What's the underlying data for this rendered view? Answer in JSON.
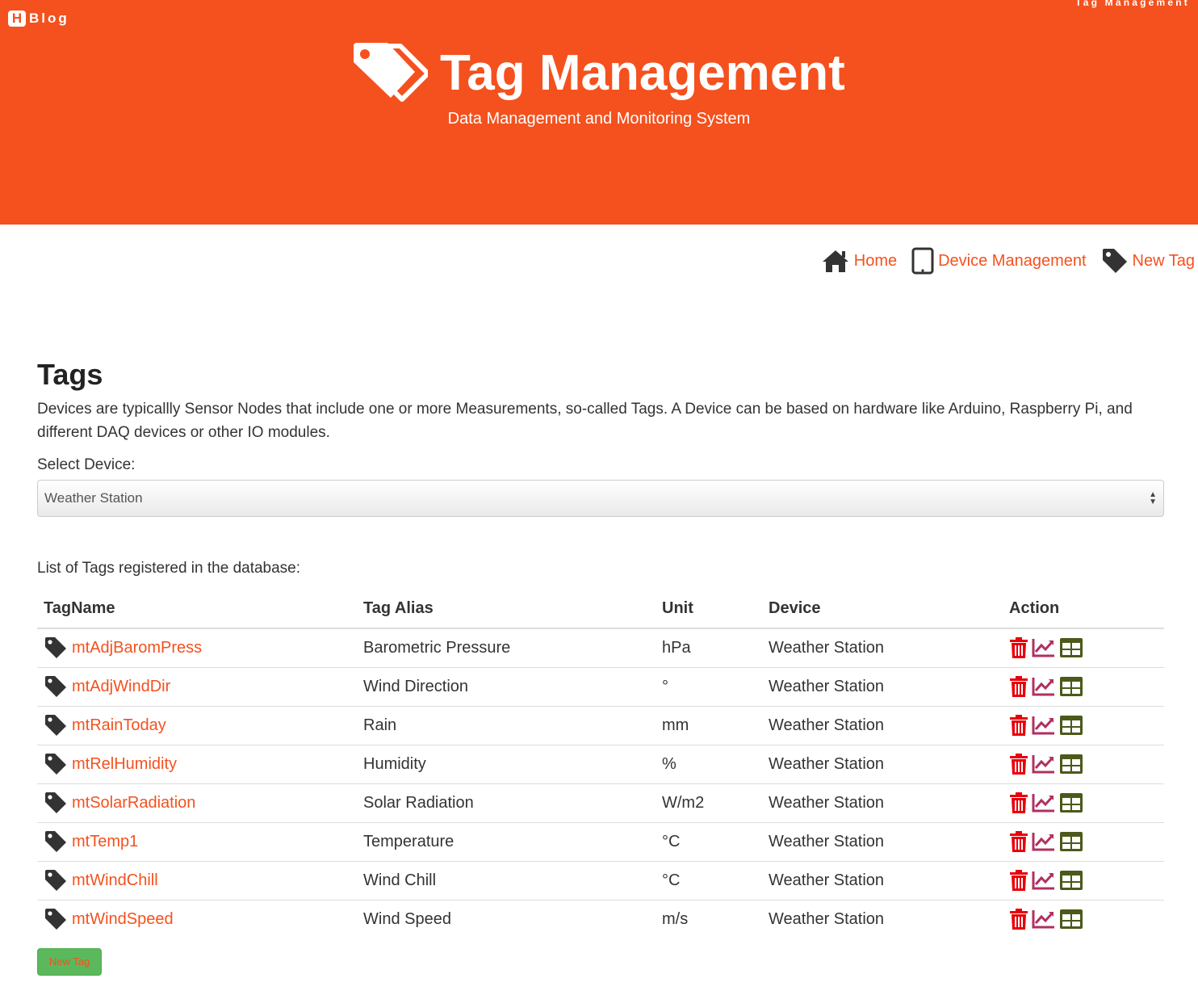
{
  "header": {
    "logo_letter": "H",
    "logo_text": "Blog",
    "top_right": "Tag Management",
    "title": "Tag Management",
    "subtitle": "Data Management and Monitoring System"
  },
  "nav": {
    "home": "Home",
    "devices": "Device Management",
    "new_tag": "New Tag"
  },
  "main": {
    "heading": "Tags",
    "description": "Devices are typicallly Sensor Nodes that include one or more Measurements, so-called Tags. A Device can be based on hardware like Arduino, Raspberry Pi, and different DAQ devices or other IO modules.",
    "select_label": "Select Device:",
    "selected_device": "Weather Station",
    "list_label": "List of Tags registered in the database:"
  },
  "table": {
    "headers": [
      "TagName",
      "Tag Alias",
      "Unit",
      "Device",
      "Action"
    ],
    "rows": [
      {
        "name": "mtAdjBaromPress",
        "alias": "Barometric Pressure",
        "unit": "hPa",
        "device": "Weather Station"
      },
      {
        "name": "mtAdjWindDir",
        "alias": "Wind Direction",
        "unit": "°",
        "device": "Weather Station"
      },
      {
        "name": "mtRainToday",
        "alias": "Rain",
        "unit": "mm",
        "device": "Weather Station"
      },
      {
        "name": "mtRelHumidity",
        "alias": "Humidity",
        "unit": "%",
        "device": "Weather Station"
      },
      {
        "name": "mtSolarRadiation",
        "alias": "Solar Radiation",
        "unit": "W/m2",
        "device": "Weather Station"
      },
      {
        "name": "mtTemp1",
        "alias": "Temperature",
        "unit": "°C",
        "device": "Weather Station"
      },
      {
        "name": "mtWindChill",
        "alias": "Wind Chill",
        "unit": "°C",
        "device": "Weather Station"
      },
      {
        "name": "mtWindSpeed",
        "alias": "Wind Speed",
        "unit": "m/s",
        "device": "Weather Station"
      }
    ]
  },
  "button": {
    "new_tag": "New Tag"
  },
  "icons": {
    "tag": "tag-icon",
    "home": "home-icon",
    "device": "tablet-icon",
    "delete": "trash-icon",
    "chart": "line-chart-icon",
    "table": "table-icon"
  },
  "colors": {
    "brand": "#f4511e",
    "delete": "#e8000b",
    "chart": "#b03060",
    "table": "#4a5a1a",
    "button": "#5cb85c"
  }
}
